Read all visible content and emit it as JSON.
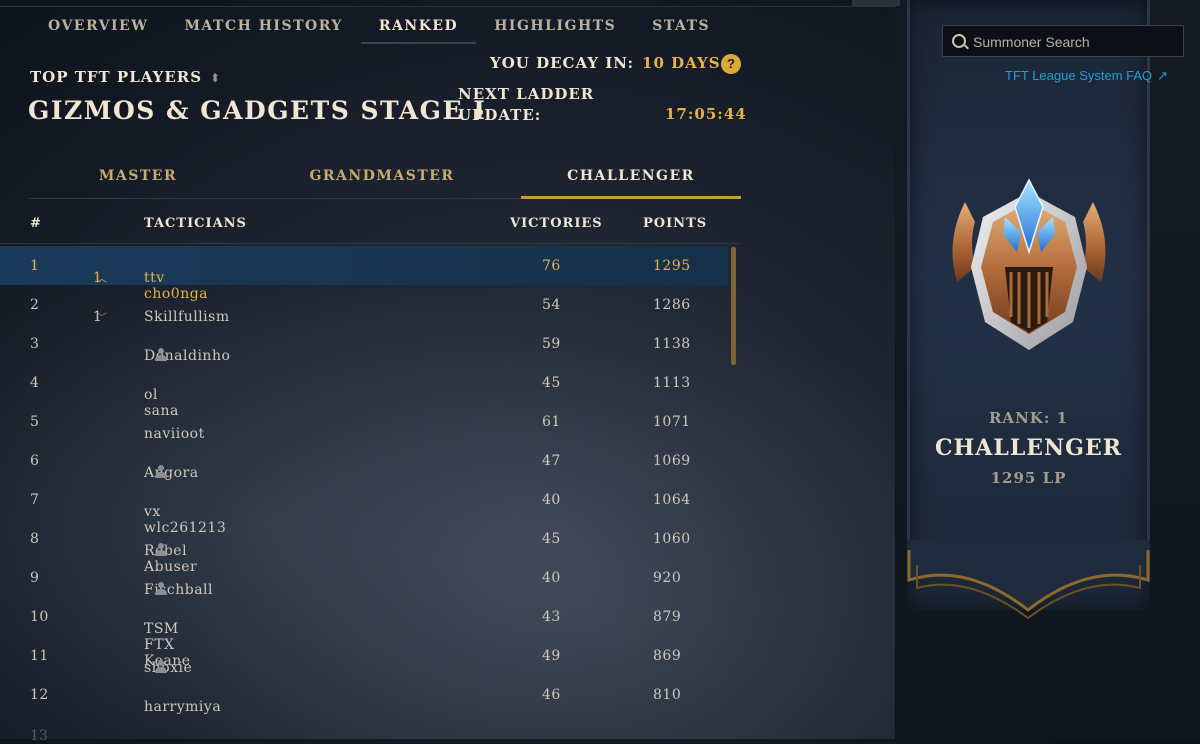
{
  "nav": {
    "tabs": [
      {
        "label": "OVERVIEW"
      },
      {
        "label": "MATCH HISTORY"
      },
      {
        "label": "RANKED",
        "active": true
      },
      {
        "label": "HIGHLIGHTS"
      },
      {
        "label": "STATS"
      }
    ]
  },
  "header": {
    "leaderboard_selector": "TOP TFT PLAYERS",
    "set_name": "GIZMOS & GADGETS STAGE I",
    "decay_label": "YOU DECAY IN:",
    "decay_value": "10 DAYS",
    "help_icon_text": "?",
    "ladder_label_line1": "NEXT LADDER",
    "ladder_label_line2": "UPDATE:",
    "ladder_time": "17:05:44"
  },
  "tiers": {
    "tabs": [
      {
        "label": "MASTER"
      },
      {
        "label": "GRANDMASTER"
      },
      {
        "label": "CHALLENGER",
        "active": true
      }
    ]
  },
  "table": {
    "headers": {
      "rank": "#",
      "name": "TACTICIANS",
      "victories": "VICTORIES",
      "points": "POINTS"
    },
    "rows": [
      {
        "rank": "1",
        "change": "1",
        "dir": "up",
        "name": "ttv cho0nga",
        "friend": false,
        "victories": "76",
        "points": "1295",
        "selected": true
      },
      {
        "rank": "2",
        "change": "1",
        "dir": "down",
        "name": "Skillfullism",
        "friend": false,
        "victories": "54",
        "points": "1286"
      },
      {
        "rank": "3",
        "change": "",
        "dir": "",
        "name": "Donaldinho",
        "friend": true,
        "victories": "59",
        "points": "1138"
      },
      {
        "rank": "4",
        "change": "",
        "dir": "",
        "name": "ol sana",
        "friend": false,
        "victories": "45",
        "points": "1113"
      },
      {
        "rank": "5",
        "change": "",
        "dir": "",
        "name": "naviioot",
        "friend": false,
        "victories": "61",
        "points": "1071"
      },
      {
        "rank": "6",
        "change": "",
        "dir": "",
        "name": "Angora",
        "friend": true,
        "victories": "47",
        "points": "1069"
      },
      {
        "rank": "7",
        "change": "",
        "dir": "",
        "name": "vx wlc261213",
        "friend": false,
        "victories": "40",
        "points": "1064"
      },
      {
        "rank": "8",
        "change": "",
        "dir": "",
        "name": "Rebel Abuser",
        "friend": true,
        "victories": "45",
        "points": "1060"
      },
      {
        "rank": "9",
        "change": "",
        "dir": "",
        "name": "Fischball",
        "friend": true,
        "victories": "40",
        "points": "920"
      },
      {
        "rank": "10",
        "change": "",
        "dir": "",
        "name": "TSM FTX Keane",
        "friend": false,
        "victories": "43",
        "points": "879"
      },
      {
        "rank": "11",
        "change": "",
        "dir": "",
        "name": "shoxie",
        "friend": true,
        "victories": "49",
        "points": "869"
      },
      {
        "rank": "12",
        "change": "",
        "dir": "",
        "name": "harrymiya",
        "friend": false,
        "victories": "46",
        "points": "810"
      }
    ]
  },
  "sidebar": {
    "search_placeholder": "Summoner Search",
    "faq_link": "TFT League System FAQ",
    "rank_label": "RANK: 1",
    "tier_name": "CHALLENGER",
    "lp": "1295 LP"
  },
  "colors": {
    "gold": "#c89b3c",
    "highlight_text": "#e8b24a",
    "link": "#1f9fd4",
    "selected_row": "#1b3b5c"
  }
}
